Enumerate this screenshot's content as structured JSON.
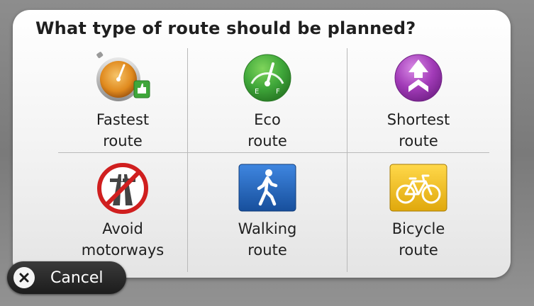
{
  "dialog": {
    "title": "What type of route should be planned?"
  },
  "options": [
    {
      "line1": "Fastest",
      "line2": "route",
      "icon": "stopwatch-thumbs-up-icon"
    },
    {
      "line1": "Eco",
      "line2": "route",
      "icon": "fuel-gauge-icon"
    },
    {
      "line1": "Shortest",
      "line2": "route",
      "icon": "converging-arrows-icon"
    },
    {
      "line1": "Avoid",
      "line2": "motorways",
      "icon": "no-motorway-icon"
    },
    {
      "line1": "Walking",
      "line2": "route",
      "icon": "pedestrian-icon"
    },
    {
      "line1": "Bicycle",
      "line2": "route",
      "icon": "bicycle-icon"
    }
  ],
  "eco_gauge": {
    "left_mark": "E",
    "right_mark": "F"
  },
  "cancel": {
    "label": "Cancel",
    "icon": "close-icon"
  },
  "colors": {
    "eco_green": "#3fa73a",
    "shortest_purple": "#a23bb8",
    "walking_blue": "#1f5fb8",
    "bicycle_yellow": "#f2c21b",
    "avoid_red": "#d01f1f"
  }
}
